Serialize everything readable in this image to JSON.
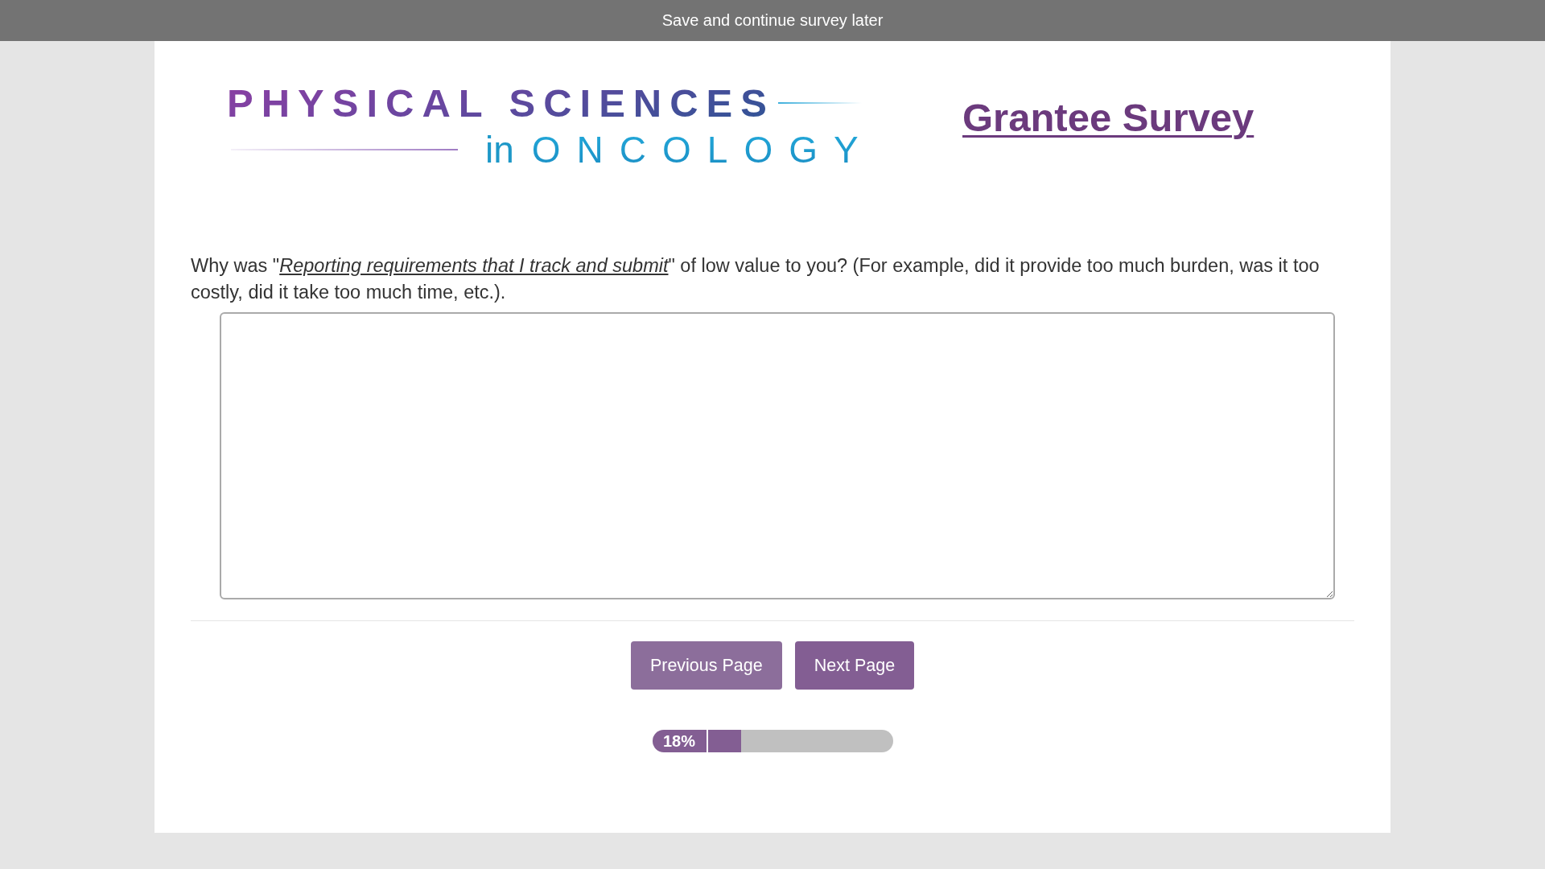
{
  "top_bar": {
    "link": "Save and continue survey later"
  },
  "logo": {
    "line_1": "PHYSICAL SCIENCES",
    "line_2_prefix": "in",
    "line_2": "ONCOLOGY"
  },
  "title": "Grantee Survey",
  "question": {
    "text": "Why was \"*Reporting requirements that I track and submit*\" of low value to you? (For example, did it provide too much burden, was it too costly, did it take too much time, etc.)."
  },
  "buttons": [
    {
      "label": "Previous Page",
      "kind": "previous"
    },
    {
      "label": "Next Page",
      "kind": "next"
    }
  ],
  "progress": {
    "label": "18%",
    "level": 0.18
  }
}
